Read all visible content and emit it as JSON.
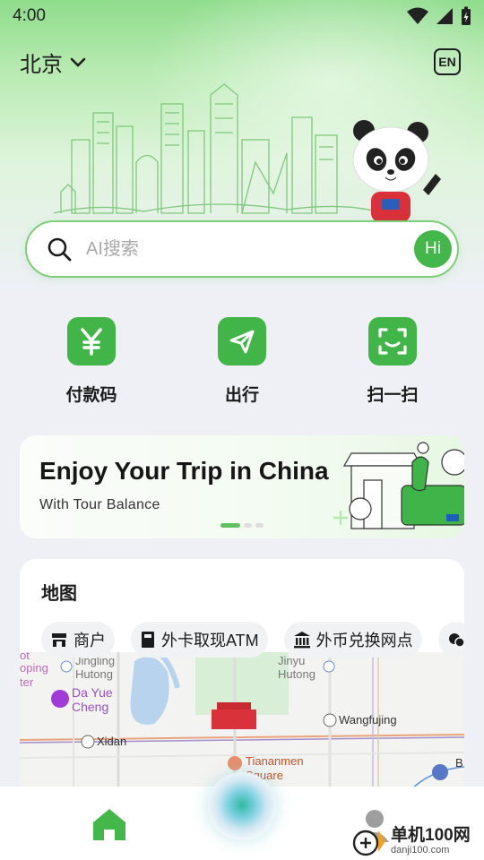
{
  "status_bar": {
    "time": "4:00"
  },
  "header": {
    "city": "北京",
    "language_button": "EN"
  },
  "search": {
    "placeholder": "AI搜索",
    "hi_label": "Hi"
  },
  "quick_actions": [
    {
      "label": "付款码",
      "icon": "yuan-icon"
    },
    {
      "label": "出行",
      "icon": "paper-plane-icon"
    },
    {
      "label": "扫一扫",
      "icon": "scan-icon"
    }
  ],
  "banner": {
    "title": "Enjoy Your Trip in China",
    "subtitle": "With Tour Balance",
    "slide_count": 3,
    "active_slide": 1
  },
  "map": {
    "title": "地图",
    "chips": [
      {
        "label": "商户",
        "icon": "store-icon"
      },
      {
        "label": "外卡取现ATM",
        "icon": "atm-card-icon"
      },
      {
        "label": "外币兑换网点",
        "icon": "bank-icon"
      }
    ],
    "places": {
      "da_yue_cheng_line1": "Da Yue",
      "da_yue_cheng_line2": "Cheng",
      "xidan": "Xidan",
      "wangfujing": "Wangfujing",
      "tiananmen_line1": "Tiananmen",
      "tiananmen_line2": "Square",
      "jingling_hutong_line1": "Jingling",
      "jingling_hutong_line2": "Hutong",
      "shopping_center_line1": "ot",
      "shopping_center_line2": "oping",
      "shopping_center_line3": "ter",
      "jinyu_hutong_line1": "Jinyu",
      "jinyu_hutong_line2": "Hutong",
      "right_edge_label": "B"
    }
  },
  "watermark": {
    "main": "单机100网",
    "sub": "danji100.com"
  },
  "colors": {
    "brand_green": "#42b548",
    "search_border": "#7ccf77"
  }
}
